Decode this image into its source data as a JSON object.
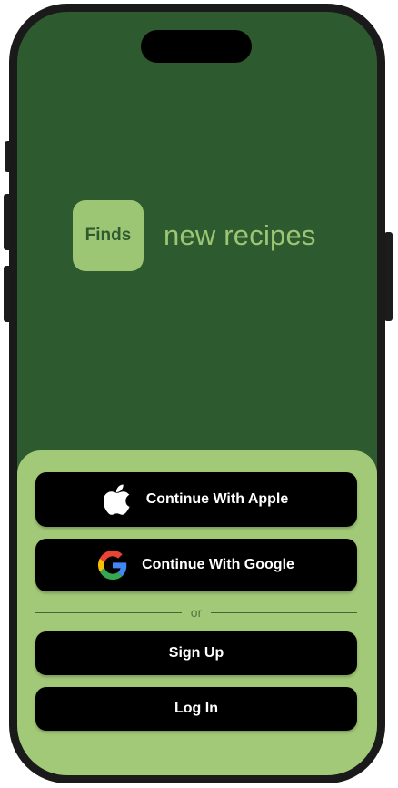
{
  "brand": {
    "logo_text": "Finds",
    "tagline": "new recipes"
  },
  "auth": {
    "apple_label": "Continue With Apple",
    "google_label": "Continue With Google",
    "divider_text": "or",
    "signup_label": "Sign Up",
    "login_label": "Log In"
  },
  "icons": {
    "apple": "apple-logo-icon",
    "google": "google-logo-icon"
  },
  "colors": {
    "background": "#2e5a2f",
    "accent": "#9dc674",
    "sheet": "#a2c977",
    "button": "#000000",
    "button_text": "#ffffff"
  }
}
